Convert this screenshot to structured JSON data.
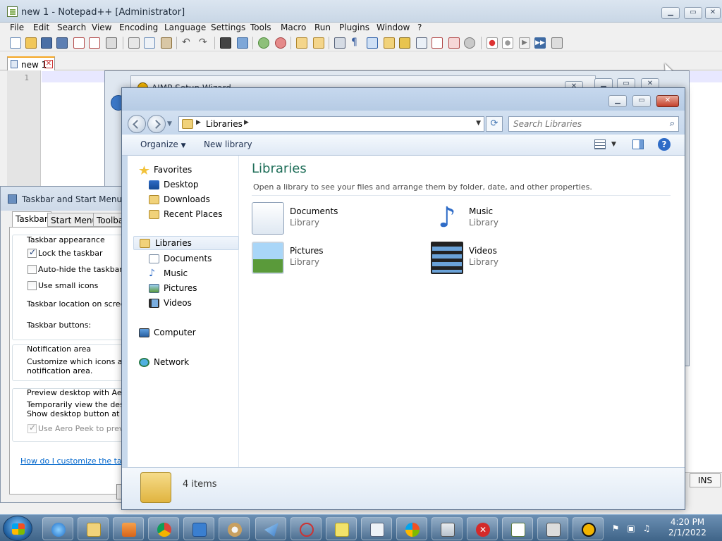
{
  "notepadpp": {
    "title": "new 1 - Notepad++ [Administrator]",
    "menu": [
      "File",
      "Edit",
      "Search",
      "View",
      "Encoding",
      "Language",
      "Settings",
      "Tools",
      "Macro",
      "Run",
      "Plugins",
      "Window",
      "?"
    ],
    "tab": {
      "label": "new 1"
    },
    "line_number": "1",
    "status_mode": "INS",
    "accent_color": "#f5a623"
  },
  "aimp": {
    "title": "AIMP Setup Wizard"
  },
  "taskbar_props": {
    "title": "Taskbar and Start Menu Pro",
    "tabs": [
      "Taskbar",
      "Start Menu",
      "Toolbar"
    ],
    "appearance": {
      "group_label": "Taskbar appearance",
      "lock": {
        "label": "Lock the taskbar",
        "checked": true
      },
      "autohide": {
        "label": "Auto-hide the taskbar",
        "checked": false
      },
      "small_icons": {
        "label": "Use small icons",
        "checked": false
      },
      "location_label": "Taskbar location on screen:",
      "buttons_label": "Taskbar buttons:"
    },
    "notification": {
      "group_label": "Notification area",
      "line1": "Customize which icons and n",
      "line2": "notification area."
    },
    "aero": {
      "group_label": "Preview desktop with Aero P",
      "line1": "Temporarily view the deskto",
      "line2": "Show desktop button at end",
      "peek": {
        "label": "Use Aero Peek to preview",
        "checked": true,
        "disabled": true
      }
    },
    "help_link": "How do I customize the taskba"
  },
  "explorer": {
    "breadcrumb": [
      "Libraries"
    ],
    "search_placeholder": "Search Libraries",
    "commands": {
      "organize": "Organize",
      "new_library": "New library"
    },
    "nav": {
      "favorites": {
        "label": "Favorites",
        "items": [
          "Desktop",
          "Downloads",
          "Recent Places"
        ]
      },
      "libraries": {
        "label": "Libraries",
        "items": [
          "Documents",
          "Music",
          "Pictures",
          "Videos"
        ]
      },
      "computer": "Computer",
      "network": "Network"
    },
    "header": "Libraries",
    "subheader": "Open a library to see your files and arrange them by folder, date, and other properties.",
    "libraries": [
      {
        "name": "Documents",
        "kind": "Library"
      },
      {
        "name": "Music",
        "kind": "Library"
      },
      {
        "name": "Pictures",
        "kind": "Library"
      },
      {
        "name": "Videos",
        "kind": "Library"
      }
    ],
    "item_count": "4 items"
  },
  "taskbar": {
    "apps": [
      "Internet Explorer",
      "Windows Explorer",
      "Media Player",
      "Chrome",
      "Remote Desktop",
      "Paint",
      "Send",
      "Snipping Tool",
      "Sticky Notes",
      "Document Viewer",
      "Windows Update",
      "Calculator",
      "Close",
      "Notepad++",
      "Archive",
      "AIMP"
    ],
    "time": "4:20 PM",
    "date": "2/1/2022"
  }
}
